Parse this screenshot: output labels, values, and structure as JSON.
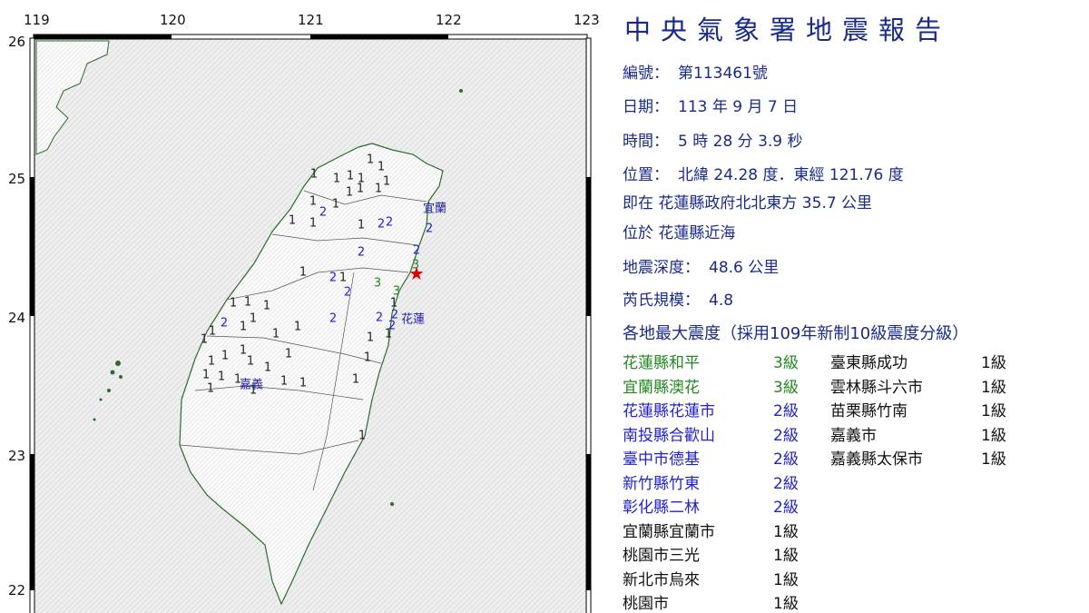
{
  "map": {
    "lon_ticks": [
      "119",
      "120",
      "121",
      "122",
      "123"
    ],
    "lat_ticks": [
      "26",
      "25",
      "24",
      "23",
      "22"
    ],
    "place_labels": [
      "宜蘭",
      "花蓮",
      "嘉義"
    ],
    "intensity_marks": [
      {
        "v": "1",
        "c": "#222222"
      },
      {
        "v": "1",
        "c": "#222222"
      },
      {
        "v": "1",
        "c": "#222222"
      },
      {
        "v": "1",
        "c": "#222222"
      },
      {
        "v": "1",
        "c": "#222222"
      },
      {
        "v": "1",
        "c": "#222222"
      },
      {
        "v": "1",
        "c": "#222222"
      },
      {
        "v": "1",
        "c": "#222222"
      },
      {
        "v": "1",
        "c": "#222222"
      },
      {
        "v": "1",
        "c": "#222222"
      },
      {
        "v": "2",
        "c": "#2222cc"
      },
      {
        "v": "1",
        "c": "#222222"
      },
      {
        "v": "1",
        "c": "#222222"
      },
      {
        "v": "1",
        "c": "#222222"
      },
      {
        "v": "2",
        "c": "#2222cc"
      },
      {
        "v": "2",
        "c": "#2222cc"
      },
      {
        "v": "1",
        "c": "#222222"
      },
      {
        "v": "1",
        "c": "#222222"
      },
      {
        "v": "2",
        "c": "#2222cc"
      },
      {
        "v": "2",
        "c": "#2222cc"
      },
      {
        "v": "2",
        "c": "#2222cc"
      },
      {
        "v": "3",
        "c": "#228822"
      },
      {
        "v": "1",
        "c": "#222222"
      },
      {
        "v": "2",
        "c": "#2222cc"
      },
      {
        "v": "1",
        "c": "#222222"
      },
      {
        "v": "2",
        "c": "#2222cc"
      },
      {
        "v": "3",
        "c": "#228822"
      },
      {
        "v": "3",
        "c": "#228822"
      },
      {
        "v": "1",
        "c": "#222222"
      },
      {
        "v": "1",
        "c": "#222222"
      },
      {
        "v": "1",
        "c": "#222222"
      },
      {
        "v": "2",
        "c": "#2222cc"
      },
      {
        "v": "2",
        "c": "#2222cc"
      },
      {
        "v": "2",
        "c": "#2222cc"
      },
      {
        "v": "2",
        "c": "#2222cc"
      },
      {
        "v": "2",
        "c": "#2222cc"
      },
      {
        "v": "1",
        "c": "#222222"
      },
      {
        "v": "1",
        "c": "#222222"
      },
      {
        "v": "1",
        "c": "#222222"
      },
      {
        "v": "1",
        "c": "#222222"
      },
      {
        "v": "1",
        "c": "#222222"
      },
      {
        "v": "1",
        "c": "#222222"
      },
      {
        "v": "1",
        "c": "#222222"
      },
      {
        "v": "1",
        "c": "#222222"
      },
      {
        "v": "1",
        "c": "#222222"
      },
      {
        "v": "1",
        "c": "#222222"
      },
      {
        "v": "1",
        "c": "#222222"
      },
      {
        "v": "1",
        "c": "#222222"
      },
      {
        "v": "1",
        "c": "#222222"
      },
      {
        "v": "1",
        "c": "#222222"
      },
      {
        "v": "1",
        "c": "#222222"
      },
      {
        "v": "1",
        "c": "#222222"
      },
      {
        "v": "1",
        "c": "#222222"
      },
      {
        "v": "1",
        "c": "#222222"
      },
      {
        "v": "1",
        "c": "#222222"
      },
      {
        "v": "1",
        "c": "#222222"
      },
      {
        "v": "1",
        "c": "#222222"
      },
      {
        "v": "1",
        "c": "#222222"
      },
      {
        "v": "1",
        "c": "#222222"
      },
      {
        "v": "1",
        "c": "#222222"
      },
      {
        "v": "1",
        "c": "#222222"
      }
    ],
    "epicenter_symbol": "★",
    "colors": {
      "level3": "#228822",
      "level2": "#2222cc",
      "level1": "#222222",
      "epicenter": "#e00000",
      "title": "#1a2a8a"
    }
  },
  "report": {
    "title": "中央氣象署地震報告",
    "number_label": "編號：",
    "number": "第113461號",
    "date_label": "日期：",
    "date": "113 年 9 月 7 日",
    "time_label": "時間：",
    "time": "5 時 28 分 3.9 秒",
    "location_label": "位置：",
    "location": "北緯 24.28 度．東經 121.76 度",
    "near": "即在 花蓮縣政府北北東方 35.7 公里",
    "at": "位於 花蓮縣近海",
    "depth_label": "地震深度：",
    "depth": "48.6 公里",
    "magnitude_label": "芮氏規模：",
    "magnitude": "4.8",
    "intensity_header": "各地最大震度（採用109年新制10級震度分級）",
    "stations_left": [
      {
        "name": "花蓮縣和平",
        "level": "3級",
        "color": "#228822"
      },
      {
        "name": "宜蘭縣澳花",
        "level": "3級",
        "color": "#228822"
      },
      {
        "name": "花蓮縣花蓮市",
        "level": "2級",
        "color": "#2222cc"
      },
      {
        "name": "南投縣合歡山",
        "level": "2級",
        "color": "#2222cc"
      },
      {
        "name": "臺中市德基",
        "level": "2級",
        "color": "#2222cc"
      },
      {
        "name": "新竹縣竹東",
        "level": "2級",
        "color": "#2222cc"
      },
      {
        "name": "彰化縣二林",
        "level": "2級",
        "color": "#2222cc"
      },
      {
        "name": "宜蘭縣宜蘭市",
        "level": "1級",
        "color": "#111111"
      },
      {
        "name": "桃園市三光",
        "level": "1級",
        "color": "#111111"
      },
      {
        "name": "新北市烏來",
        "level": "1級",
        "color": "#111111"
      },
      {
        "name": "桃園市",
        "level": "1級",
        "color": "#111111"
      }
    ],
    "stations_right": [
      {
        "name": "臺東縣成功",
        "level": "1級",
        "color": "#111111"
      },
      {
        "name": "雲林縣斗六市",
        "level": "1級",
        "color": "#111111"
      },
      {
        "name": "苗栗縣竹南",
        "level": "1級",
        "color": "#111111"
      },
      {
        "name": "嘉義市",
        "level": "1級",
        "color": "#111111"
      },
      {
        "name": "嘉義縣太保市",
        "level": "1級",
        "color": "#111111"
      }
    ]
  }
}
